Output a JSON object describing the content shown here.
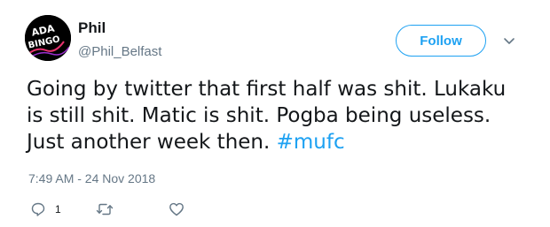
{
  "user": {
    "name": "Phil",
    "handle": "@Phil_Belfast",
    "avatar_text_top": "ADA",
    "avatar_text_bottom": "BINGO"
  },
  "follow_button": {
    "label": "Follow"
  },
  "tweet": {
    "text": "Going by twitter that first half was shit. Lukaku is still shit. Matic is shit. Pogba being useless. Just another week then.",
    "hashtag": "#mufc",
    "timestamp": "7:49 AM - 24 Nov 2018"
  },
  "actions": {
    "reply_count": "1"
  },
  "colors": {
    "accent": "#1da1f2",
    "secondary_text": "#657786",
    "primary_text": "#14171a"
  },
  "icons": {
    "menu": "chevron-down-icon",
    "reply": "reply-icon",
    "retweet": "retweet-icon",
    "like": "heart-icon"
  }
}
